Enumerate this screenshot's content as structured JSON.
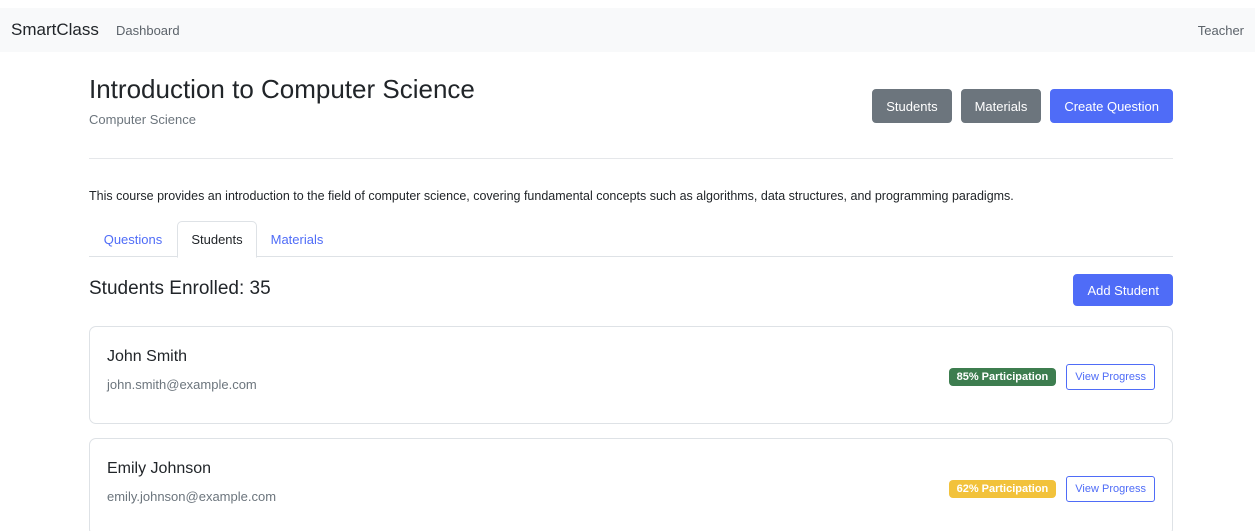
{
  "navbar": {
    "brand": "SmartClass",
    "dashboard_link": "Dashboard",
    "user_label": "Teacher"
  },
  "course": {
    "title": "Introduction to Computer Science",
    "subject": "Computer Science",
    "description": "This course provides an introduction to the field of computer science, covering fundamental concepts such as algorithms, data structures, and programming paradigms."
  },
  "header_actions": {
    "students_label": "Students",
    "materials_label": "Materials",
    "create_question_label": "Create Question"
  },
  "tabs": [
    {
      "label": "Questions",
      "active": false
    },
    {
      "label": "Students",
      "active": true
    },
    {
      "label": "Materials",
      "active": false
    }
  ],
  "students_section": {
    "heading": "Students Enrolled: 35",
    "add_student_label": "Add Student"
  },
  "students": [
    {
      "name": "John Smith",
      "email": "john.smith@example.com",
      "participation": "85% Participation",
      "participation_color": "#3d7d4f",
      "view_progress_label": "View Progress"
    },
    {
      "name": "Emily Johnson",
      "email": "emily.johnson@example.com",
      "participation": "62% Participation",
      "participation_color": "#f2c23b",
      "view_progress_label": "View Progress"
    }
  ],
  "colors": {
    "primary": "#4f6cf7",
    "secondary": "#6c757d",
    "navbar_bg": "#f8f9fa"
  }
}
